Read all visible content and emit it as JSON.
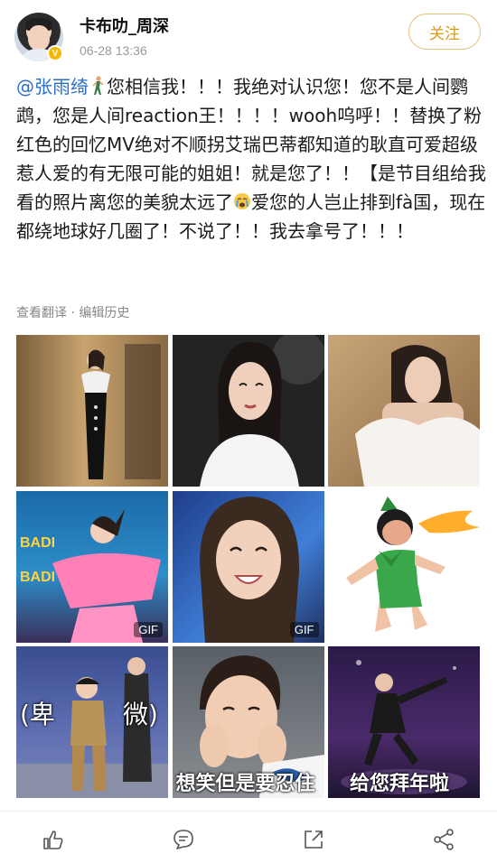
{
  "post": {
    "username": "卡布叻_周深",
    "time": "06-28 13:36",
    "follow_label": "关注",
    "text_segments": {
      "mention": "@张雨绮",
      "body": "您相信我！！！我绝对认识您！您不是人间鹦鹉，您是人间reaction王！！！！wooh呜呼！！替换了粉红色的回忆MV绝对不顺拐艾瑞巴蒂都知道的耿直可爱超级惹人爱的有无限可能的姐姐！就是您了！！【是节目组给我看的照片离您的美貌太远了",
      "tail": "爱您的人岂止排到fà国，现在都绕地球好几圈了！不说了！！我去拿号了！！！"
    },
    "meta": "查看翻译 · 编辑历史"
  },
  "images": [
    {
      "name": "photo-black-dress"
    },
    {
      "name": "photo-white-feather"
    },
    {
      "name": "photo-offshoulder"
    },
    {
      "name": "gif-pink-dance",
      "badge": "GIF"
    },
    {
      "name": "gif-smile-stage",
      "badge": "GIF"
    },
    {
      "name": "meme-green-cartoon"
    },
    {
      "name": "meme-humble",
      "caption_left": "(卑",
      "caption_right": "微)"
    },
    {
      "name": "meme-trying-not-laugh",
      "caption": "想笑但是要忍住"
    },
    {
      "name": "meme-new-year",
      "caption": "给您拜年啦"
    }
  ],
  "icons": {
    "like": "thumbs-up-icon",
    "comment": "comment-icon",
    "repost": "repost-icon",
    "share": "share-icon"
  },
  "colors": {
    "mention": "#2b6ec7",
    "follow": "#d99a1b",
    "verified": "#f5b800"
  }
}
